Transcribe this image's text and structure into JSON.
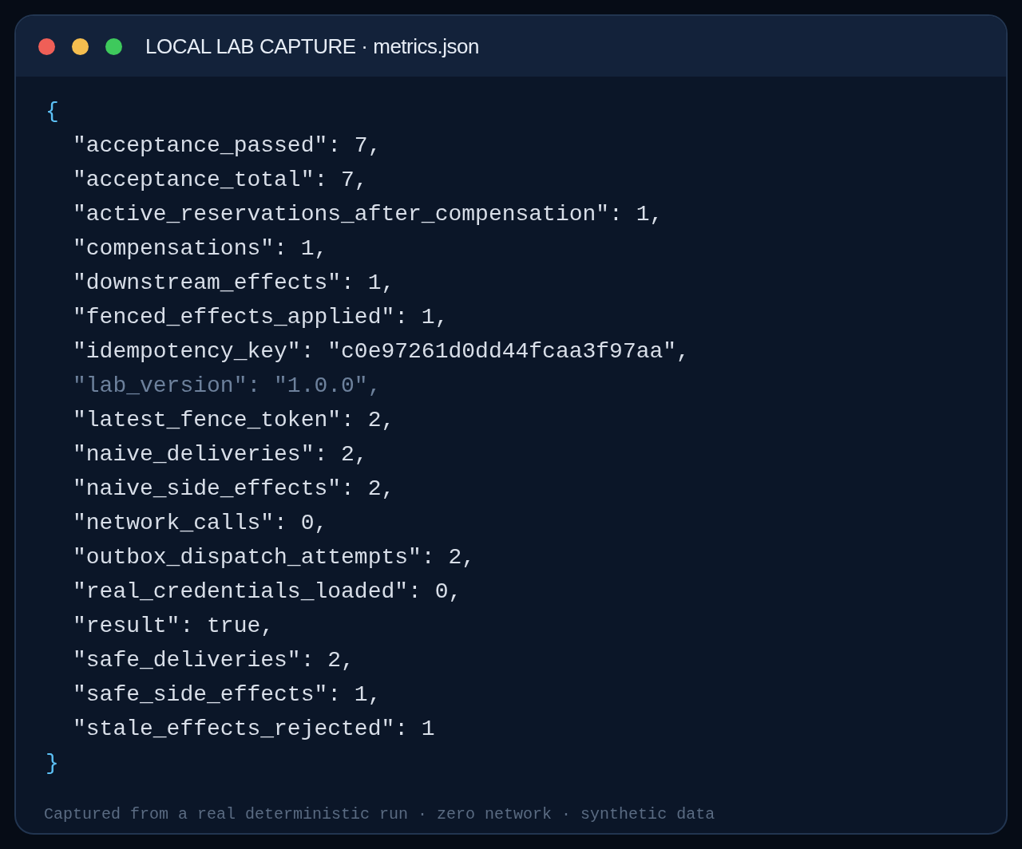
{
  "window": {
    "title": "LOCAL LAB CAPTURE · metrics.json",
    "controls": [
      {
        "color": "#ef5f57"
      },
      {
        "color": "#f5be4f"
      },
      {
        "color": "#3ec95c"
      }
    ]
  },
  "code": {
    "open": "{",
    "close": "}",
    "lines": [
      {
        "text": "\"acceptance_passed\": 7,",
        "dimmed": false
      },
      {
        "text": "\"acceptance_total\": 7,",
        "dimmed": false
      },
      {
        "text": "\"active_reservations_after_compensation\": 1,",
        "dimmed": false
      },
      {
        "text": "\"compensations\": 1,",
        "dimmed": false
      },
      {
        "text": "\"downstream_effects\": 1,",
        "dimmed": false
      },
      {
        "text": "\"fenced_effects_applied\": 1,",
        "dimmed": false
      },
      {
        "text": "\"idempotency_key\": \"c0e97261d0dd44fcaa3f97aa\",",
        "dimmed": false
      },
      {
        "text": "\"lab_version\": \"1.0.0\",",
        "dimmed": true
      },
      {
        "text": "\"latest_fence_token\": 2,",
        "dimmed": false
      },
      {
        "text": "\"naive_deliveries\": 2,",
        "dimmed": false
      },
      {
        "text": "\"naive_side_effects\": 2,",
        "dimmed": false
      },
      {
        "text": "\"network_calls\": 0,",
        "dimmed": false
      },
      {
        "text": "\"outbox_dispatch_attempts\": 2,",
        "dimmed": false
      },
      {
        "text": "\"real_credentials_loaded\": 0,",
        "dimmed": false
      },
      {
        "text": "\"result\": true,",
        "dimmed": false
      },
      {
        "text": "\"safe_deliveries\": 2,",
        "dimmed": false
      },
      {
        "text": "\"safe_side_effects\": 1,",
        "dimmed": false
      },
      {
        "text": "\"stale_effects_rejected\": 1",
        "dimmed": false
      }
    ]
  },
  "footer": "Captured from a real deterministic run · zero network · synthetic data"
}
